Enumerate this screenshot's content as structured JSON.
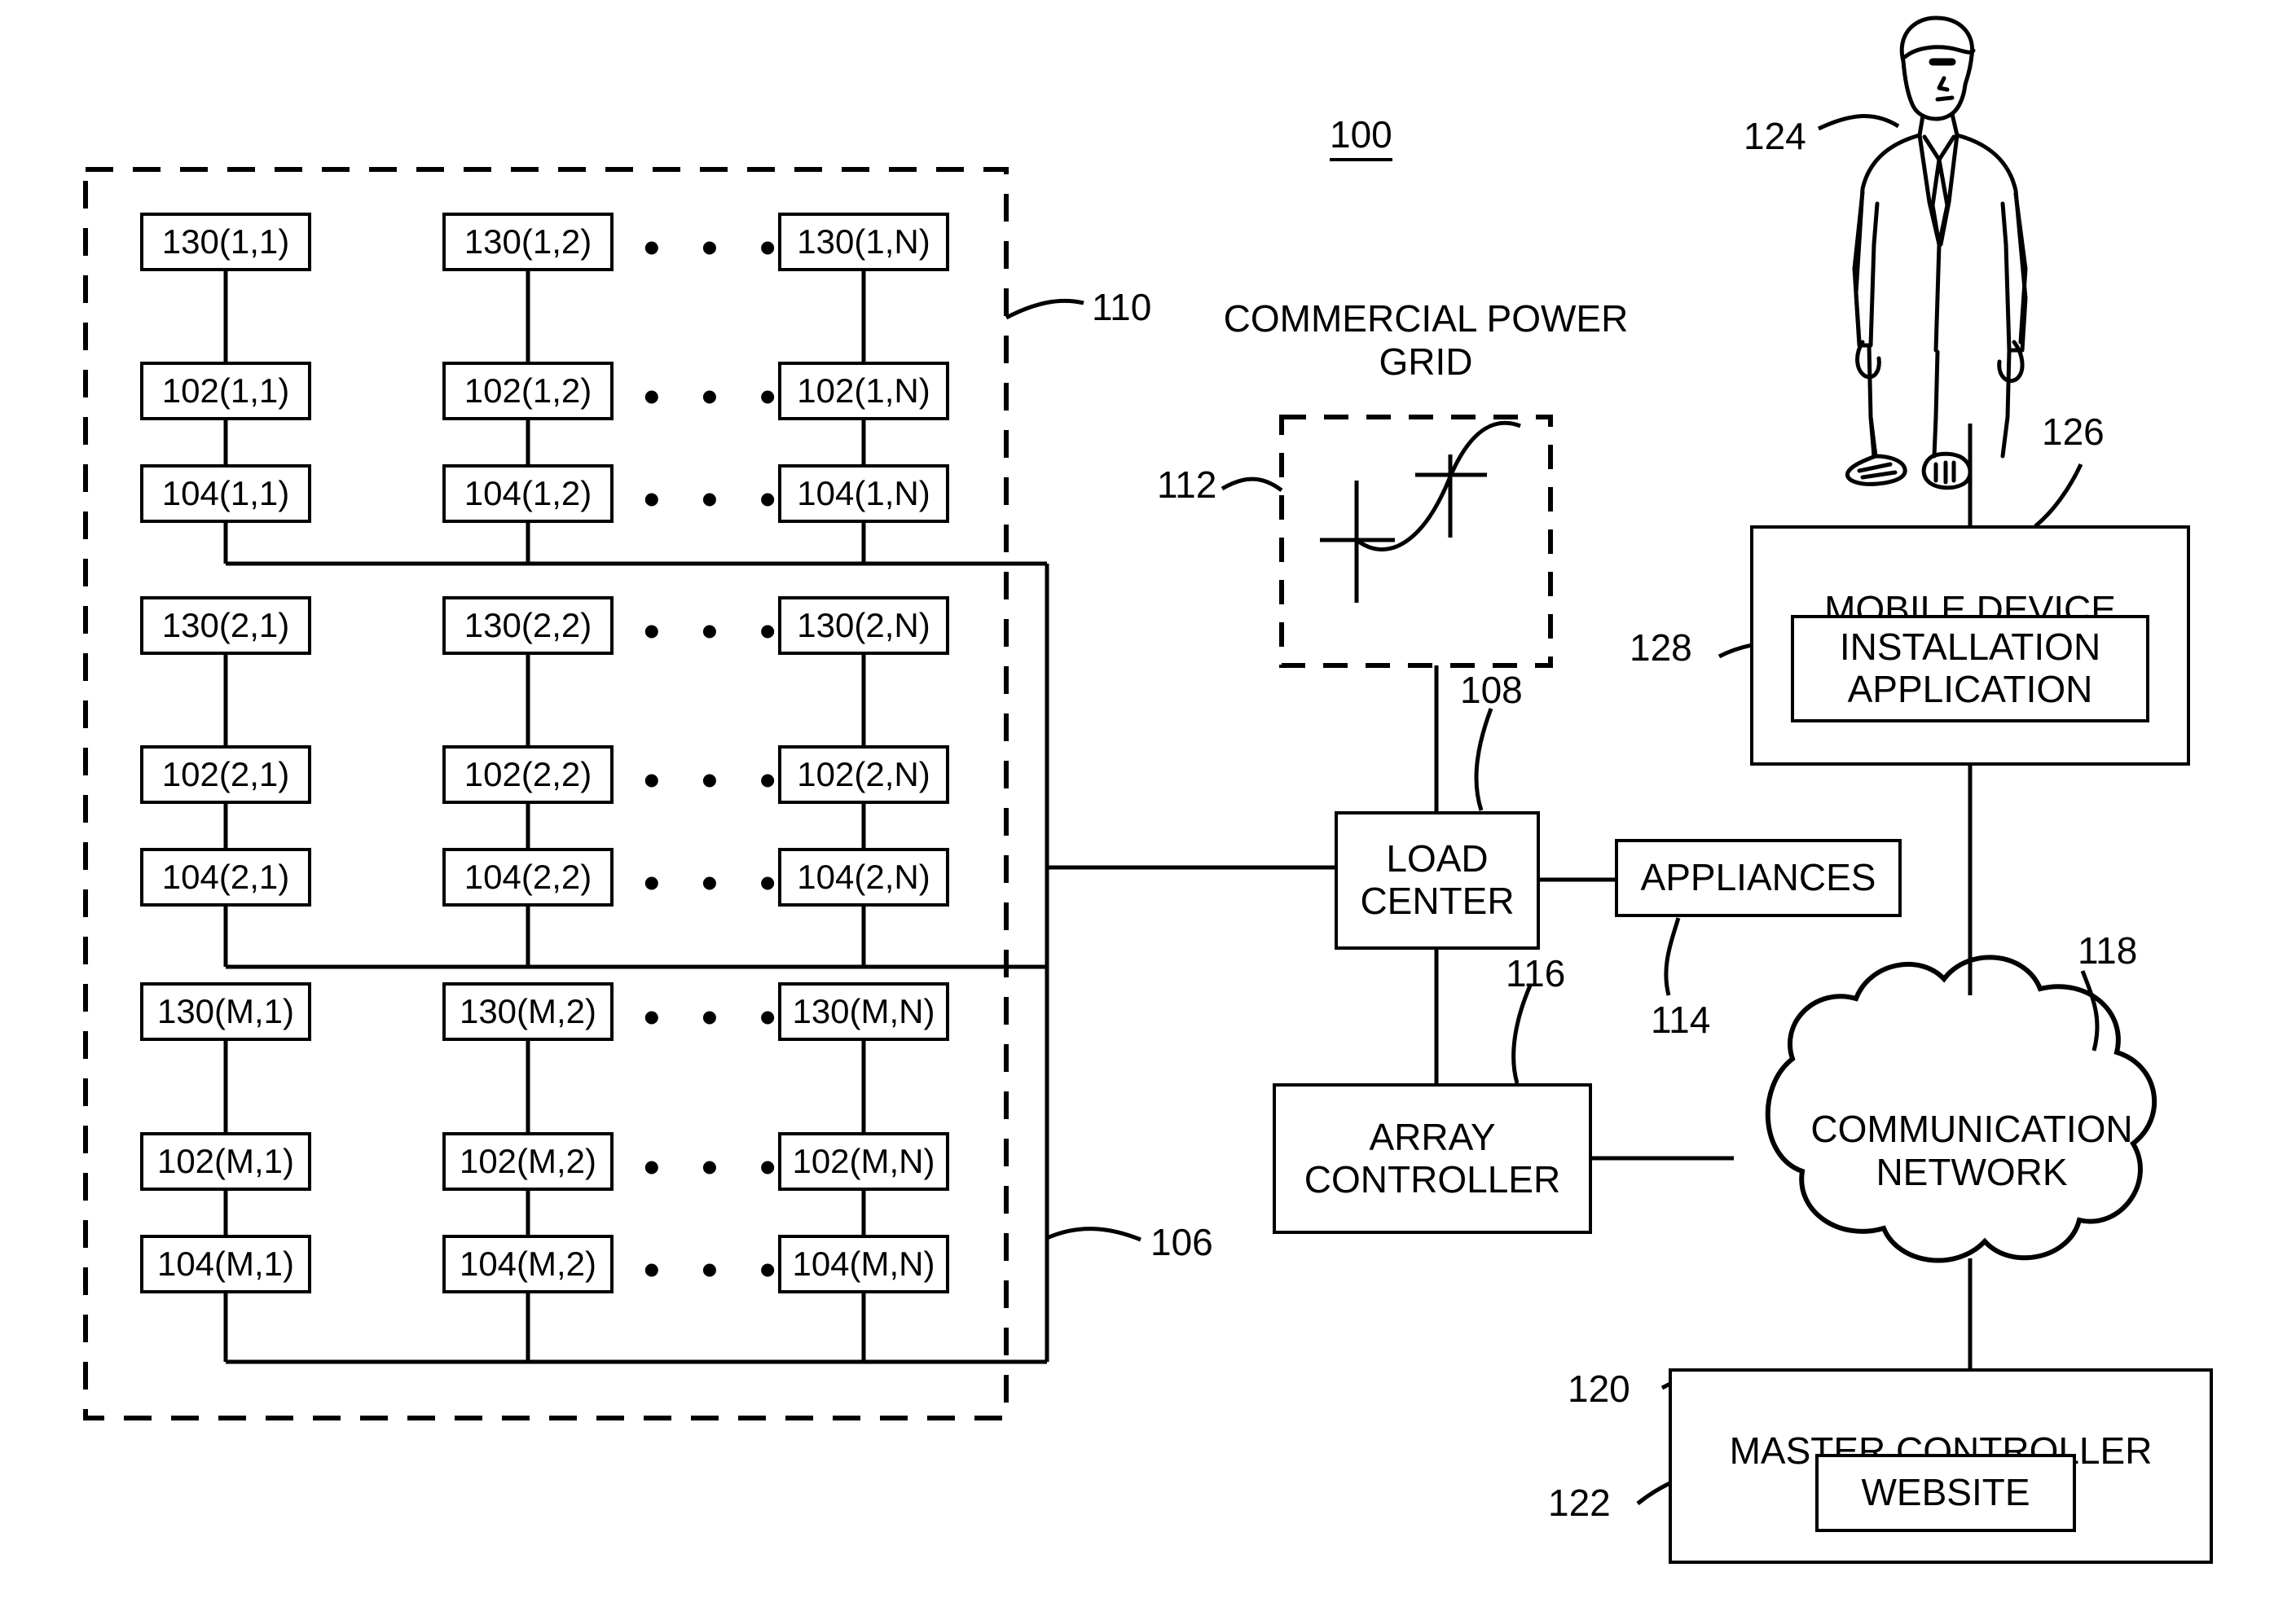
{
  "figure": {
    "number": "100",
    "title_ref": "100"
  },
  "solar_array": {
    "enclosure_ref": "110",
    "bus_ref": "106",
    "ellipsis": "• • •",
    "rows": [
      {
        "row_key": "1",
        "columns": [
          {
            "m130": "130(1,1)",
            "m102": "102(1,1)",
            "m104": "104(1,1)"
          },
          {
            "m130": "130(1,2)",
            "m102": "102(1,2)",
            "m104": "104(1,2)"
          },
          {
            "m130": "130(1,N)",
            "m102": "102(1,N)",
            "m104": "104(1,N)"
          }
        ]
      },
      {
        "row_key": "2",
        "columns": [
          {
            "m130": "130(2,1)",
            "m102": "102(2,1)",
            "m104": "104(2,1)"
          },
          {
            "m130": "130(2,2)",
            "m102": "102(2,2)",
            "m104": "104(2,2)"
          },
          {
            "m130": "130(2,N)",
            "m102": "102(2,N)",
            "m104": "104(2,N)"
          }
        ]
      },
      {
        "row_key": "M",
        "columns": [
          {
            "m130": "130(M,1)",
            "m102": "102(M,1)",
            "m104": "104(M,1)"
          },
          {
            "m130": "130(M,2)",
            "m102": "102(M,2)",
            "m104": "104(M,2)"
          },
          {
            "m130": "130(M,N)",
            "m102": "102(M,N)",
            "m104": "104(M,N)"
          }
        ]
      }
    ]
  },
  "power_grid": {
    "caption": "COMMERCIAL POWER\nGRID",
    "ref": "112",
    "icon": "transmission-tower-icon"
  },
  "load_center": {
    "label": "LOAD\nCENTER",
    "ref": "108"
  },
  "appliances": {
    "label": "APPLIANCES",
    "ref": "114"
  },
  "array_controller": {
    "label": "ARRAY\nCONTROLLER",
    "ref": "116"
  },
  "communication_network": {
    "label": "COMMUNICATION\nNETWORK",
    "ref": "118"
  },
  "person": {
    "ref": "124",
    "icon": "person-icon"
  },
  "mobile_device": {
    "label": "MOBILE DEVICE",
    "ref": "126",
    "application": {
      "label": "INSTALLATION\nAPPLICATION",
      "ref": "128"
    }
  },
  "master_controller": {
    "label": "MASTER CONTROLLER",
    "ref": "120",
    "website": {
      "label": "WEBSITE",
      "ref": "122"
    }
  },
  "colors": {
    "ink": "#000000",
    "paper": "#ffffff"
  }
}
